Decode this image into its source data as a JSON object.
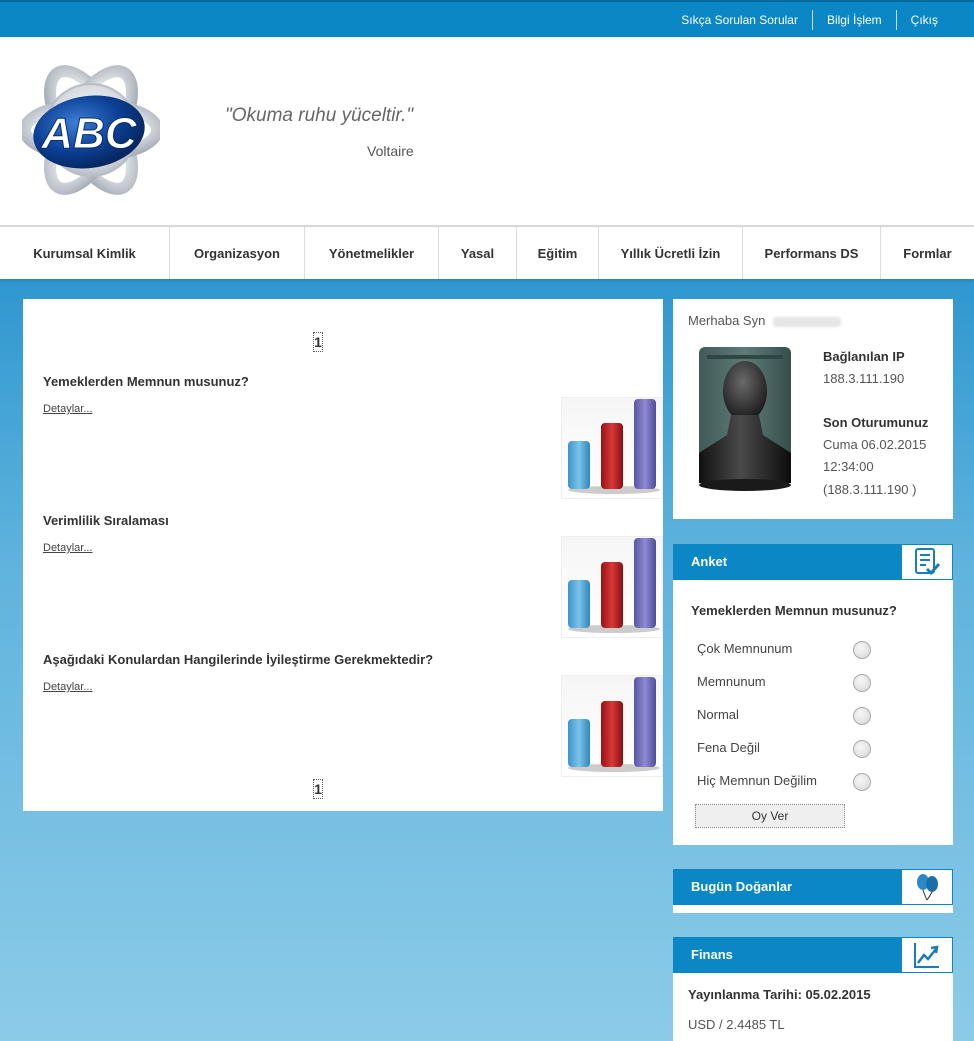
{
  "topbar": {
    "links": [
      "Sıkça Sorulan Sorular",
      "Bilgi İşlem",
      "Çıkış"
    ]
  },
  "header": {
    "logo_text": "ABC",
    "quote": "\"Okuma ruhu yüceltir.\"",
    "author": "Voltaire"
  },
  "nav": {
    "items": [
      "Kurumsal Kimlik",
      "Organizasyon",
      "Yönetmelikler",
      "Yasal",
      "Eğitim",
      "Yıllık Ücretli İzin",
      "Performans DS",
      "Formlar"
    ]
  },
  "surveys": {
    "page_top": "1",
    "page_bottom": "1",
    "items": [
      {
        "title": "Yemeklerden Memnun musunuz?",
        "detail": "Detaylar..."
      },
      {
        "title": "Verimlilik Sıralaması",
        "detail": "Detaylar..."
      },
      {
        "title": "Aşağıdaki Konulardan Hangilerinde İyileştirme Gerekmektedir?",
        "detail": "Detaylar..."
      }
    ]
  },
  "user": {
    "greeting": "Merhaba Syn",
    "ip_label": "Bağlanılan IP",
    "ip_value": "188.3.111.190",
    "last_login_label": "Son Oturumunuz",
    "last_login_date": "Cuma 06.02.2015",
    "last_login_time": "12:34:00",
    "last_login_ip": "(188.3.111.190 )"
  },
  "poll": {
    "title": "Anket",
    "question": "Yemeklerden Memnun musunuz?",
    "options": [
      "Çok Memnunum",
      "Memnunum",
      "Normal",
      "Fena Değil",
      "Hiç Memnun Değilim"
    ],
    "vote_label": "Oy Ver"
  },
  "birthdays": {
    "title": "Bugün Doğanlar"
  },
  "finance": {
    "title": "Finans",
    "date_line": "Yayınlanma Tarihi: 05.02.2015",
    "usd_line": "USD / 2.4485 TL"
  },
  "colors": {
    "brand_blue": "#0a87c4",
    "bar_blue": "#4aa3d4",
    "bar_red": "#b0181c",
    "bar_purple": "#6a66b4"
  }
}
